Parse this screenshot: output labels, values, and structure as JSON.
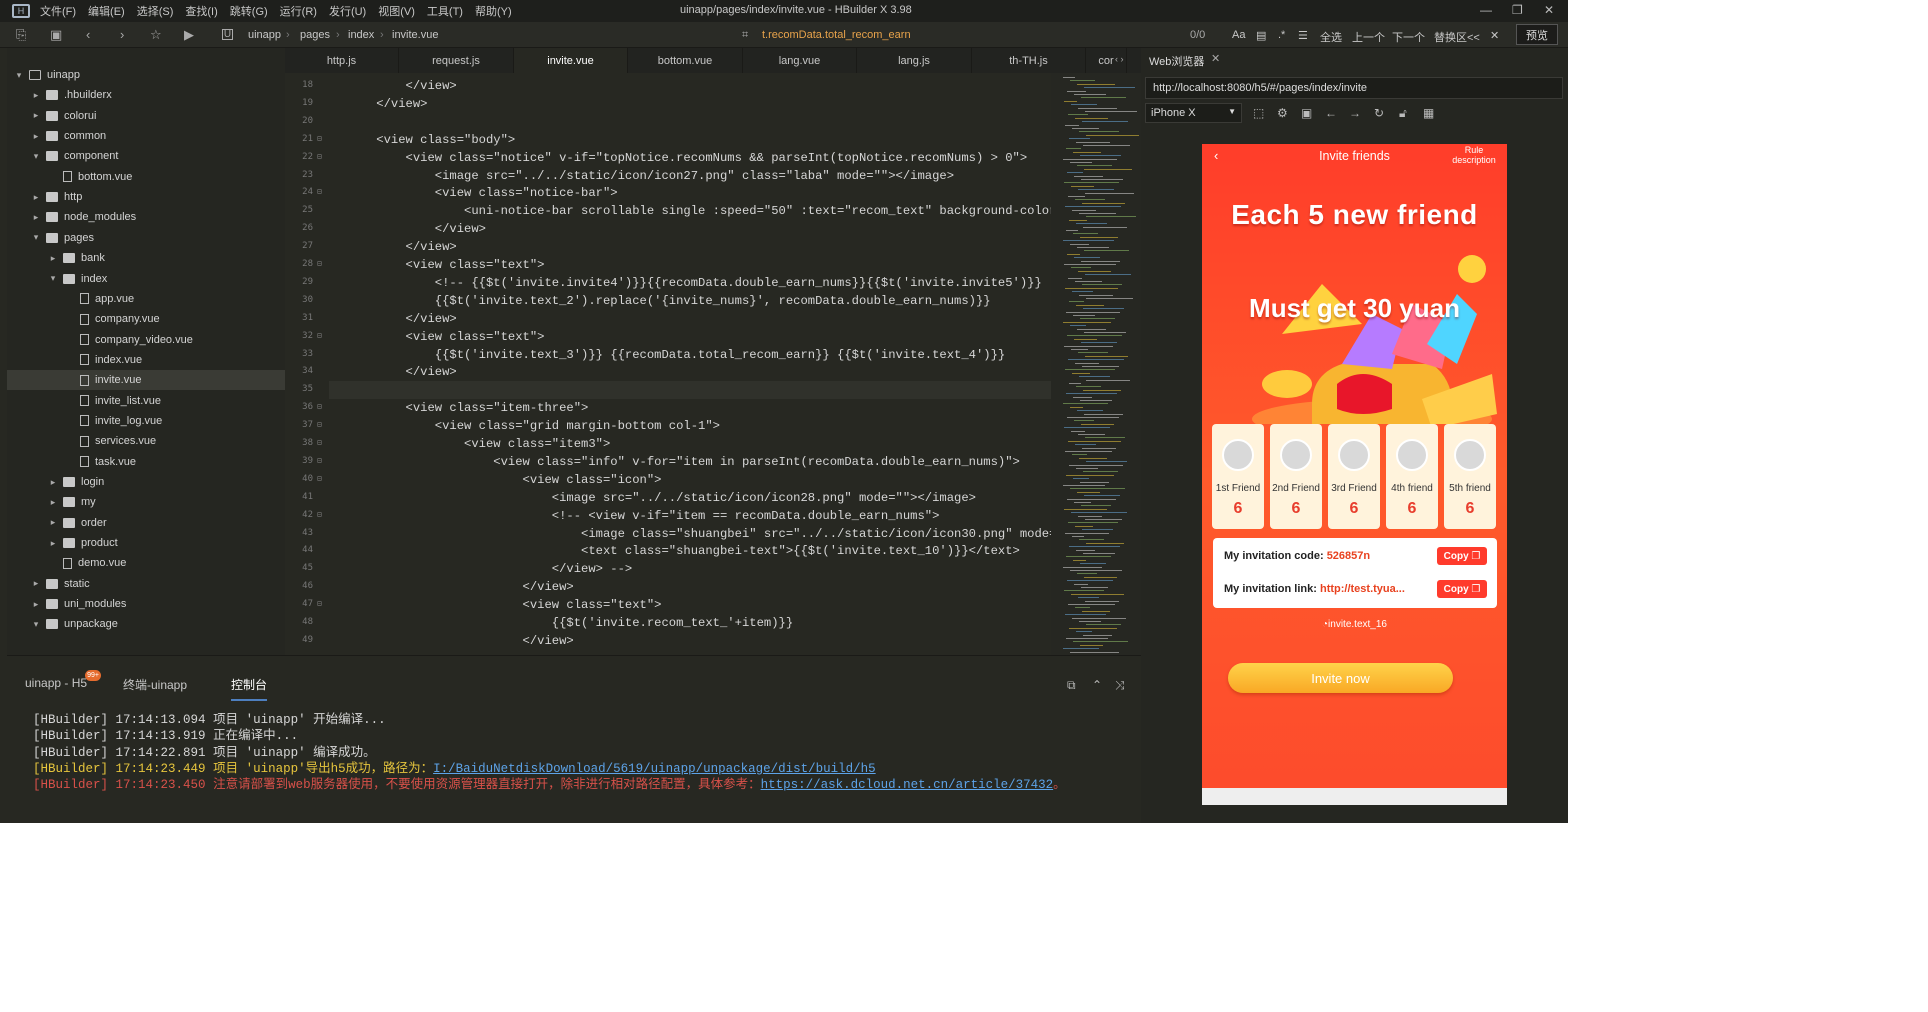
{
  "menubar": {
    "items": [
      "文件(F)",
      "编辑(E)",
      "选择(S)",
      "查找(I)",
      "跳转(G)",
      "运行(R)",
      "发行(U)",
      "视图(V)",
      "工具(T)",
      "帮助(Y)"
    ],
    "title": "uinapp/pages/index/invite.vue - HBuilder X 3.98"
  },
  "toolbar": {
    "breadcrumb": [
      "uinapp",
      "pages",
      "index",
      "invite.vue"
    ],
    "symbol": "t.recomData.total_recom_earn",
    "count": "0/0",
    "right_items": [
      "全选",
      "上一个",
      "下一个",
      "替换区<<"
    ],
    "preview_label": "预览"
  },
  "sidebar": {
    "items": [
      {
        "label": "uinapp",
        "type": "project",
        "arrow": "▾"
      },
      {
        "label": ".hbuilderx",
        "type": "folder",
        "arrow": "▸"
      },
      {
        "label": "colorui",
        "type": "folder",
        "arrow": "▸"
      },
      {
        "label": "common",
        "type": "folder",
        "arrow": "▸"
      },
      {
        "label": "component",
        "type": "folder",
        "arrow": "▾"
      },
      {
        "label": "bottom.vue",
        "type": "file",
        "arrow": ""
      },
      {
        "label": "http",
        "type": "folder",
        "arrow": "▸"
      },
      {
        "label": "node_modules",
        "type": "folder",
        "arrow": "▸"
      },
      {
        "label": "pages",
        "type": "folder",
        "arrow": "▾"
      },
      {
        "label": "bank",
        "type": "folder",
        "arrow": "▸"
      },
      {
        "label": "index",
        "type": "folder",
        "arrow": "▾"
      },
      {
        "label": "app.vue",
        "type": "file",
        "arrow": ""
      },
      {
        "label": "company.vue",
        "type": "file",
        "arrow": ""
      },
      {
        "label": "company_video.vue",
        "type": "file",
        "arrow": ""
      },
      {
        "label": "index.vue",
        "type": "file",
        "arrow": ""
      },
      {
        "label": "invite.vue",
        "type": "file",
        "arrow": "",
        "selected": true
      },
      {
        "label": "invite_list.vue",
        "type": "file",
        "arrow": ""
      },
      {
        "label": "invite_log.vue",
        "type": "file",
        "arrow": ""
      },
      {
        "label": "services.vue",
        "type": "file",
        "arrow": ""
      },
      {
        "label": "task.vue",
        "type": "file",
        "arrow": ""
      },
      {
        "label": "login",
        "type": "folder",
        "arrow": "▸"
      },
      {
        "label": "my",
        "type": "folder",
        "arrow": "▸"
      },
      {
        "label": "order",
        "type": "folder",
        "arrow": "▸"
      },
      {
        "label": "product",
        "type": "folder",
        "arrow": "▸"
      },
      {
        "label": "demo.vue",
        "type": "file",
        "arrow": ""
      },
      {
        "label": "static",
        "type": "folder",
        "arrow": "▸"
      },
      {
        "label": "uni_modules",
        "type": "folder",
        "arrow": "▸"
      },
      {
        "label": "unpackage",
        "type": "folder",
        "arrow": "▾"
      }
    ]
  },
  "tabs": [
    "http.js",
    "request.js",
    "invite.vue",
    "bottom.vue",
    "lang.vue",
    "lang.js",
    "th-TH.js",
    "cor"
  ],
  "active_tab": "invite.vue",
  "editor": {
    "lines": [
      {
        "n": "18",
        "fold": "",
        "text": "        </view>"
      },
      {
        "n": "19",
        "fold": "",
        "text": "    </view>"
      },
      {
        "n": "20",
        "fold": "",
        "text": ""
      },
      {
        "n": "21",
        "fold": "⊟",
        "text": "    <view class=\"body\">"
      },
      {
        "n": "22",
        "fold": "⊟",
        "text": "        <view class=\"notice\" v-if=\"topNotice.recomNums && parseInt(topNotice.recomNums) > 0\">"
      },
      {
        "n": "23",
        "fold": "",
        "text": "            <image src=\"../../static/icon/icon27.png\" class=\"laba\" mode=\"\"></image>"
      },
      {
        "n": "24",
        "fold": "⊟",
        "text": "            <view class=\"notice-bar\">"
      },
      {
        "n": "25",
        "fold": "",
        "text": "                <uni-notice-bar scrollable single :speed=\"50\" :text=\"recom_text\" background-color=\"u"
      },
      {
        "n": "26",
        "fold": "",
        "text": "            </view>"
      },
      {
        "n": "27",
        "fold": "",
        "text": "        </view>"
      },
      {
        "n": "28",
        "fold": "⊟",
        "text": "        <view class=\"text\">"
      },
      {
        "n": "29",
        "fold": "",
        "text": "            <!-- {{$t('invite.invite4')}}{{recomData.double_earn_nums}}{{$t('invite.invite5')}} -->"
      },
      {
        "n": "30",
        "fold": "",
        "text": "            {{$t('invite.text_2').replace('{invite_nums}', recomData.double_earn_nums)}}"
      },
      {
        "n": "31",
        "fold": "",
        "text": "        </view>"
      },
      {
        "n": "32",
        "fold": "⊟",
        "text": "        <view class=\"text\">"
      },
      {
        "n": "33",
        "fold": "",
        "text": "            {{$t('invite.text_3')}} {{recomData.total_recom_earn}} {{$t('invite.text_4')}}"
      },
      {
        "n": "34",
        "fold": "",
        "text": "        </view>"
      },
      {
        "n": "35",
        "fold": "",
        "text": ""
      },
      {
        "n": "36",
        "fold": "⊟",
        "text": "        <view class=\"item-three\">"
      },
      {
        "n": "37",
        "fold": "⊟",
        "text": "            <view class=\"grid margin-bottom col-1\">"
      },
      {
        "n": "38",
        "fold": "⊟",
        "text": "                <view class=\"item3\">"
      },
      {
        "n": "39",
        "fold": "⊟",
        "text": "                    <view class=\"info\" v-for=\"item in parseInt(recomData.double_earn_nums)\">"
      },
      {
        "n": "40",
        "fold": "⊟",
        "text": "                        <view class=\"icon\">"
      },
      {
        "n": "41",
        "fold": "",
        "text": "                            <image src=\"../../static/icon/icon28.png\" mode=\"\"></image>"
      },
      {
        "n": "42",
        "fold": "⊟",
        "text": "                            <!-- <view v-if=\"item == recomData.double_earn_nums\">"
      },
      {
        "n": "43",
        "fold": "",
        "text": "                                <image class=\"shuangbei\" src=\"../../static/icon/icon30.png\" mode=\"\">"
      },
      {
        "n": "44",
        "fold": "",
        "text": "                                <text class=\"shuangbei-text\">{{$t('invite.text_10')}}</text>"
      },
      {
        "n": "45",
        "fold": "",
        "text": "                            </view> -->"
      },
      {
        "n": "46",
        "fold": "",
        "text": "                        </view>"
      },
      {
        "n": "47",
        "fold": "⊟",
        "text": "                        <view class=\"text\">"
      },
      {
        "n": "48",
        "fold": "",
        "text": "                            {{$t('invite.recom_text_'+item)}}"
      },
      {
        "n": "49",
        "fold": "",
        "text": "                        </view>"
      }
    ]
  },
  "console": {
    "tabs": [
      "uinapp - H5",
      "终端-uinapp",
      "控制台"
    ],
    "badge": "99+",
    "lines": [
      {
        "prefix": "[HBuilder]",
        "time": "17:14:13.094",
        "msg": "项目 'uinapp' 开始编译...",
        "style": "normal",
        "link": ""
      },
      {
        "prefix": "[HBuilder]",
        "time": "17:14:13.919",
        "msg": "正在编译中...",
        "style": "normal",
        "link": ""
      },
      {
        "prefix": "[HBuilder]",
        "time": "17:14:22.891",
        "msg": "项目 'uinapp' 编译成功。",
        "style": "normal",
        "link": ""
      },
      {
        "prefix": "[HBuilder]",
        "time": "17:14:23.449",
        "msg": "项目 'uinapp'导出h5成功，路径为：",
        "style": "yellow",
        "link": "I:/BaiduNetdiskDownload/5619/uinapp/unpackage/dist/build/h5"
      },
      {
        "prefix": "[HBuilder]",
        "time": "17:14:23.450",
        "msg": "注意请部署到web服务器使用，不要使用资源管理器直接打开，除非进行相对路径配置，具体参考：",
        "style": "red",
        "link": "https://ask.dcloud.net.cn/article/37432",
        "tail": "。"
      }
    ]
  },
  "browser": {
    "tab_label": "Web浏览器",
    "url": "http://localhost:8080/h5/#/pages/index/invite",
    "device": "iPhone X"
  },
  "phone": {
    "title": "Invite friends",
    "rule": "Rule description",
    "headline1": "Each 5 new friend",
    "headline2": "Must get 30 yuan",
    "friends": [
      {
        "name": "1st Friend",
        "value": "6"
      },
      {
        "name": "2nd Friend",
        "value": "6"
      },
      {
        "name": "3rd Friend",
        "value": "6"
      },
      {
        "name": "4th friend",
        "value": "6"
      },
      {
        "name": "5th friend",
        "value": "6"
      }
    ],
    "code_label": "My invitation code:",
    "code_value": "526857n",
    "link_label": "My invitation link:",
    "link_value": "http://test.tyua...",
    "copy_label": "Copy",
    "hint": "invite.text_16",
    "invite_button": "Invite now"
  },
  "colors": {
    "accent": "#ff3b2c",
    "button": "#f9a825",
    "editor_bg": "#272822"
  }
}
